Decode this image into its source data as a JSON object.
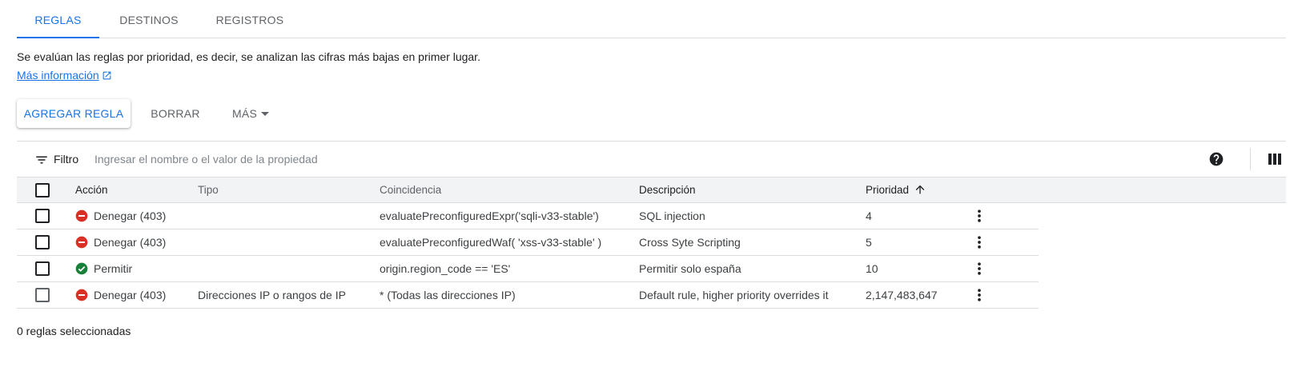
{
  "tabs": [
    {
      "label": "REGLAS",
      "active": true
    },
    {
      "label": "DESTINOS",
      "active": false
    },
    {
      "label": "REGISTROS",
      "active": false
    }
  ],
  "info": {
    "text": "Se evalúan las reglas por prioridad, es decir, se analizan las cifras más bajas en primer lugar.",
    "link": "Más información"
  },
  "toolbar": {
    "add_label": "AGREGAR REGLA",
    "delete_label": "BORRAR",
    "more_label": "MÁS"
  },
  "filter": {
    "label": "Filtro",
    "placeholder": "Ingresar el nombre o el valor de la propiedad"
  },
  "table": {
    "headers": {
      "accion": "Acción",
      "tipo": "Tipo",
      "coincidencia": "Coincidencia",
      "descripcion": "Descripción",
      "prioridad": "Prioridad"
    },
    "rows": [
      {
        "accion": "Denegar (403)",
        "status": "deny",
        "tipo": "",
        "coincidencia": "evaluatePreconfiguredExpr('sqli-v33-stable')",
        "descripcion": "SQL injection",
        "prioridad": "4"
      },
      {
        "accion": "Denegar (403)",
        "status": "deny",
        "tipo": "",
        "coincidencia": "evaluatePreconfiguredWaf( 'xss-v33-stable' )",
        "descripcion": "Cross Syte Scripting",
        "prioridad": "5"
      },
      {
        "accion": "Permitir",
        "status": "allow",
        "tipo": "",
        "coincidencia": "origin.region_code == 'ES'",
        "descripcion": "Permitir solo españa",
        "prioridad": "10"
      },
      {
        "accion": "Denegar (403)",
        "status": "deny",
        "tipo": "Direcciones IP o rangos de IP",
        "coincidencia": "* (Todas las direcciones IP)",
        "descripcion": "Default rule, higher priority overrides it",
        "prioridad": "2,147,483,647"
      }
    ]
  },
  "footer": {
    "selected_text": "0 reglas seleccionadas"
  },
  "colors": {
    "accent": "#1a73e8",
    "deny": "#d93025",
    "allow": "#188038"
  },
  "icons": {
    "filter": "filter-icon",
    "help": "help-icon",
    "columns": "columns-icon",
    "deny": "deny-icon",
    "allow": "allow-icon",
    "more": "more-vert-icon",
    "sort": "arrow-up-icon",
    "external": "open-in-new-icon"
  }
}
